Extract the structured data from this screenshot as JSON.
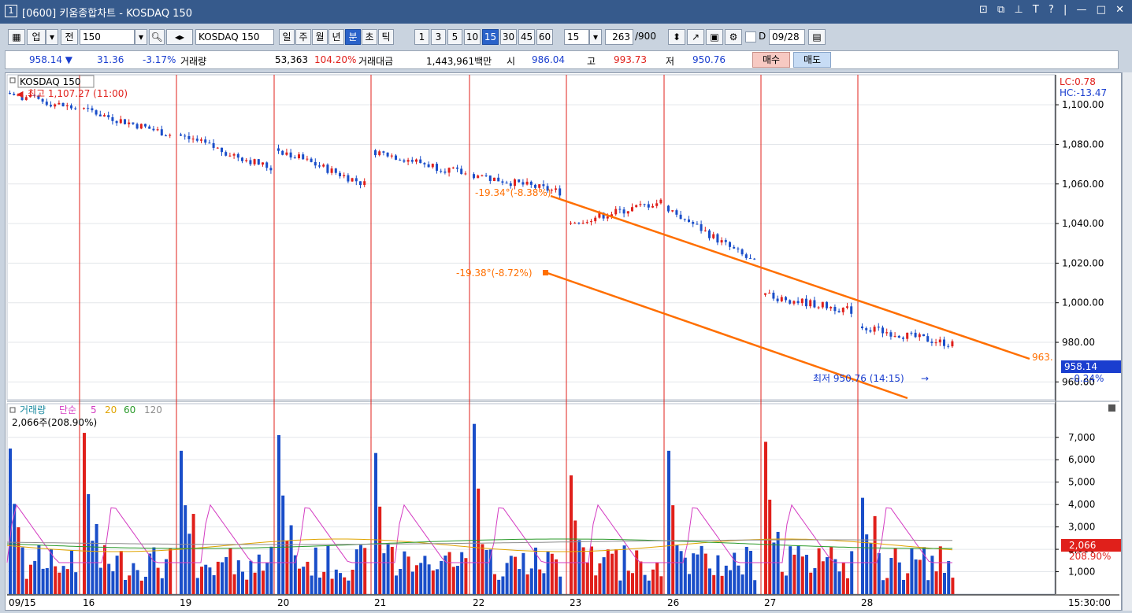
{
  "window": {
    "number": "1",
    "title": "[0600] 키움종합차트 - KOSDAQ 150",
    "controls": "⊡ ⧉ ⊥ T ? | — □ ✕"
  },
  "toolbar": {
    "market": "업",
    "scope": "전",
    "code": "150",
    "name": "KOSDAQ 150",
    "periods": [
      "일",
      "주",
      "월",
      "년",
      "분",
      "초",
      "틱"
    ],
    "selected_period": "분",
    "intervals": [
      "1",
      "3",
      "5",
      "10",
      "15",
      "30",
      "45",
      "60"
    ],
    "selected_interval": "15",
    "interval_value": "15",
    "count": "263",
    "count_max": "/900",
    "date_prefix": "D",
    "date": "09/28"
  },
  "quote": {
    "price": "958.14 ▼",
    "change": "31.36",
    "change_pct": "-3.17%",
    "volume_label": "거래량",
    "volume": "53,363",
    "volume_pct": "104.20%",
    "amount_label": "거래대금",
    "amount": "1,443,961백만",
    "open_label": "시",
    "open": "986.04",
    "high_label": "고",
    "high": "993.73",
    "low_label": "저",
    "low": "950.76",
    "buy_label": "매수",
    "sell_label": "매도"
  },
  "price_panel": {
    "legend": "KOSDAQ 150",
    "lc": "LC:0.78",
    "hc": "HC:-13.47",
    "max_label": "최고 1,107.27 (11:00)",
    "min_label": "최저 950.76 (14:15)",
    "channel_top_label": "-19.34°(-8.38%)",
    "channel_bottom_label": "-19.38°(-8.72%)",
    "channel_end_label": "963.",
    "current_price": "958.14",
    "current_pct": "-0.24%"
  },
  "volume_panel": {
    "legend_name": "거래량",
    "legend_ma": "단순",
    "ma_periods": [
      "5",
      "20",
      "60",
      "120"
    ],
    "ma_colors": [
      "#d43cc2",
      "#e0a400",
      "#2a9a2a",
      "#8c8c8c"
    ],
    "value_label": "2,066주(208.90%)",
    "current_volume": "2,066",
    "current_pct": "208.90%"
  },
  "time_axis": {
    "dates": [
      "09/15",
      "16",
      "19",
      "20",
      "21",
      "22",
      "23",
      "26",
      "27",
      "28"
    ],
    "current_time": "15:30:00"
  },
  "chart_data": {
    "type": "candlestick",
    "y_price_ticks": [
      "1,100.00",
      "1,080.00",
      "1,060.00",
      "1,040.00",
      "1,020.00",
      "1,000.00",
      "980.00",
      "960.00"
    ],
    "y_price_values": [
      1100,
      1080,
      1060,
      1040,
      1020,
      1000,
      980,
      960
    ],
    "price_ylim": [
      951,
      1108
    ],
    "y_volume_ticks": [
      "7,000",
      "6,000",
      "5,000",
      "4,000",
      "3,000",
      "2,000",
      "1,000"
    ],
    "y_volume_values": [
      7000,
      6000,
      5000,
      4000,
      3000,
      2000,
      1000
    ],
    "volume_ylim": [
      0,
      7800
    ],
    "day_path": [
      [
        1106,
        1098
      ],
      [
        1098,
        1085
      ],
      [
        1085,
        1068
      ],
      [
        1078,
        1060
      ],
      [
        1077,
        1065
      ],
      [
        1065,
        1056
      ],
      [
        1040,
        1051
      ],
      [
        1049,
        1020
      ],
      [
        1004,
        996
      ],
      [
        988,
        979
      ],
      [
        988,
        958
      ]
    ],
    "day_spikes": [
      6500,
      7200,
      6400,
      7100,
      6300,
      7600,
      5300,
      6400,
      6800,
      4300,
      2300
    ],
    "colors": {
      "up": "#e0201b",
      "down": "#1a4ec9",
      "channel": "#ff6f00",
      "day_line": "#e0201b"
    }
  }
}
